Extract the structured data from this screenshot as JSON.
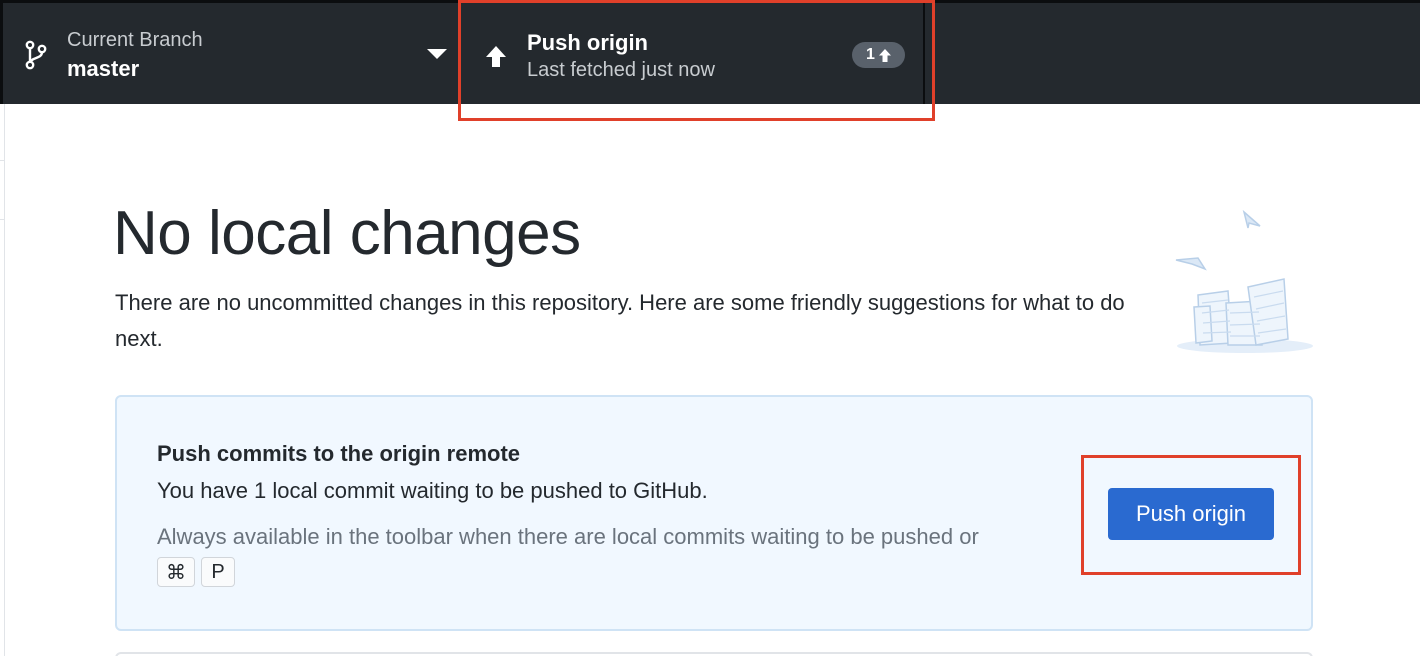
{
  "toolbar": {
    "branch": {
      "label": "Current Branch",
      "value": "master",
      "icon": "git-branch-icon"
    },
    "push": {
      "title": "Push origin",
      "subtitle": "Last fetched just now",
      "icon": "arrow-up-icon",
      "badge_count": "1"
    }
  },
  "main": {
    "heading": "No local changes",
    "description": "There are no uncommitted changes in this repository. Here are some friendly suggestions for what to do next.",
    "card": {
      "title": "Push commits to the origin remote",
      "body": "You have 1 local commit waiting to be pushed to GitHub.",
      "hint": "Always available in the toolbar when there are local commits waiting to be pushed or",
      "shortcut_keys": [
        "⌘",
        "P"
      ],
      "button_label": "Push origin"
    }
  },
  "colors": {
    "toolbar_bg": "#24292e",
    "annotation": "#e0402a",
    "primary_button": "#2a6ad0",
    "card_bg": "#f1f8ff"
  }
}
